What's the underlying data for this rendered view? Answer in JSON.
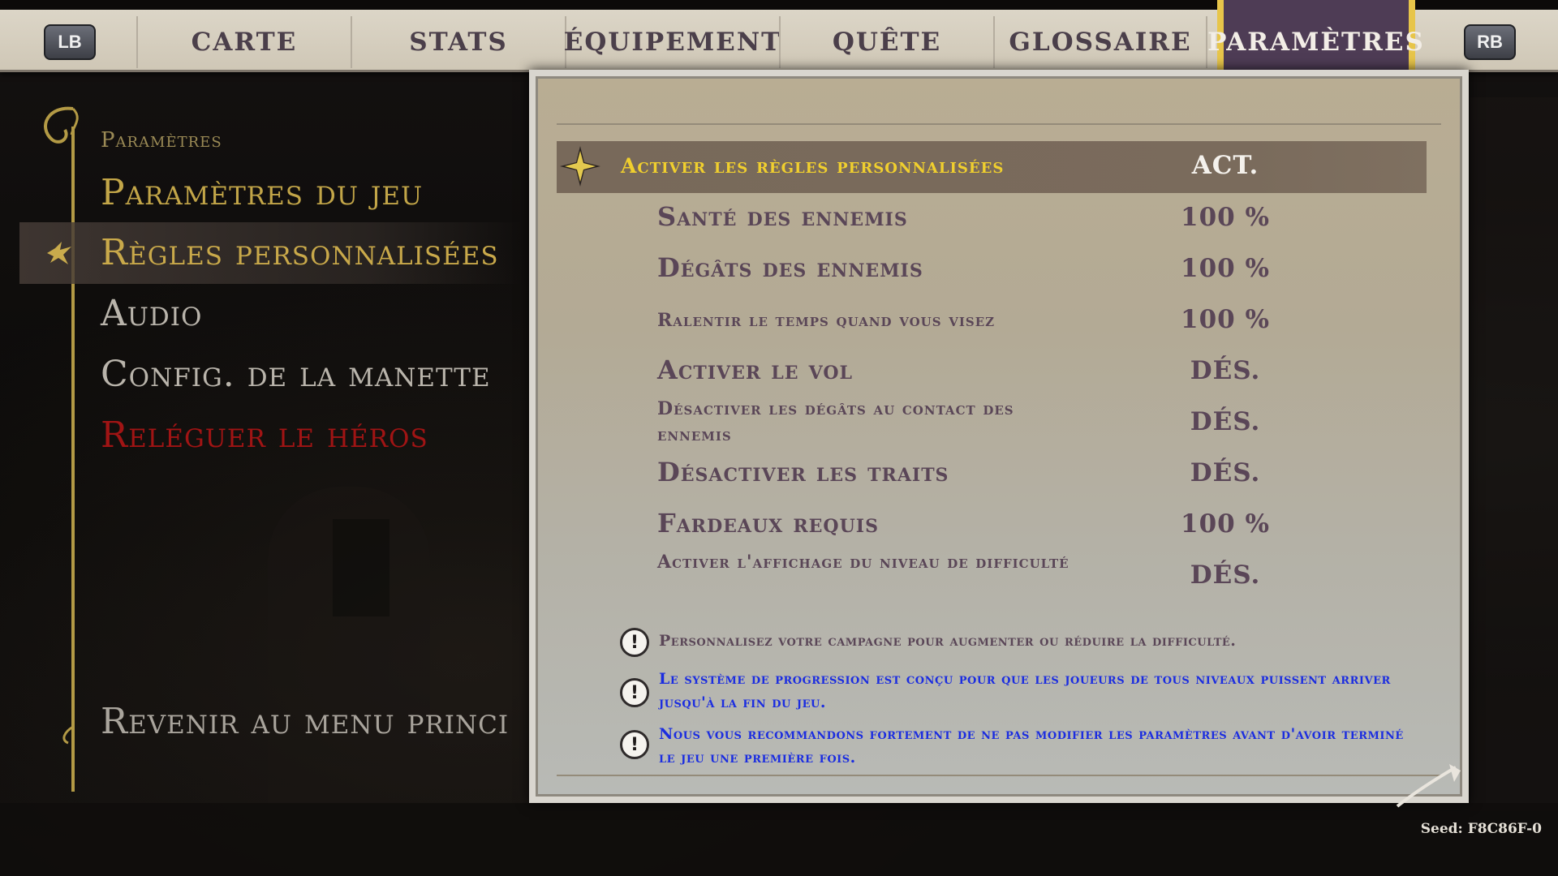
{
  "nav": {
    "left_bumper": "LB",
    "right_bumper": "RB",
    "tabs": [
      {
        "label": "CARTE"
      },
      {
        "label": "STATS"
      },
      {
        "label": "ÉQUIPEMENT"
      },
      {
        "label": "QUÊTE"
      },
      {
        "label": "GLOSSAIRE"
      },
      {
        "label": "PARAMÈTRES",
        "active": true
      }
    ]
  },
  "sidebar": {
    "heading": "Paramètres",
    "items": [
      {
        "label": "Paramètres du jeu",
        "color": "#c2a548"
      },
      {
        "label": "Règles personnalisées",
        "color": "#c9a94a",
        "selected": true
      },
      {
        "label": "Audio",
        "color": "#b9b4ab"
      },
      {
        "label": "Config. de la manette",
        "color": "#b9b4ab"
      },
      {
        "label": "Reléguer le héros",
        "color": "#a01414"
      }
    ],
    "return_label": "Revenir au menu princi"
  },
  "settings": {
    "rows": [
      {
        "label": "Activer les règles personnalisées",
        "value": "ACT."
      },
      {
        "label": "Santé des ennemis",
        "value": "100 %"
      },
      {
        "label": "Dégâts des ennemis",
        "value": "100 %"
      },
      {
        "label": "Ralentir le temps quand vous visez",
        "value": "100 %"
      },
      {
        "label": "Activer le vol",
        "value": "DÉS."
      },
      {
        "label": "Désactiver les dégâts au contact des ennemis",
        "value": "DÉS."
      },
      {
        "label": "Désactiver les traits",
        "value": "DÉS."
      },
      {
        "label": "Fardeaux requis",
        "value": "100 %"
      },
      {
        "label": "Activer l'affichage du niveau de difficulté",
        "value": "DÉS."
      }
    ]
  },
  "notices": [
    {
      "text": "Personnalisez votre campagne pour augmenter ou réduire la difficulté.",
      "color": "#5a4657"
    },
    {
      "text": "Le système de progression est conçu pour que les joueurs de tous niveaux puissent arriver jusqu'à la fin du jeu.",
      "color": "#1b2de0"
    },
    {
      "text": "Nous vous recommandons fortement de ne pas modifier les paramètres avant d'avoir terminé le jeu une première fois.",
      "color": "#1b2de0"
    }
  ],
  "footer": {
    "seed": "Seed: F8C86F-0"
  },
  "colors": {
    "accent_gold": "#f0cf2e",
    "highlight_row": "#78695a",
    "active_tab_banner": "#4e3c55"
  }
}
